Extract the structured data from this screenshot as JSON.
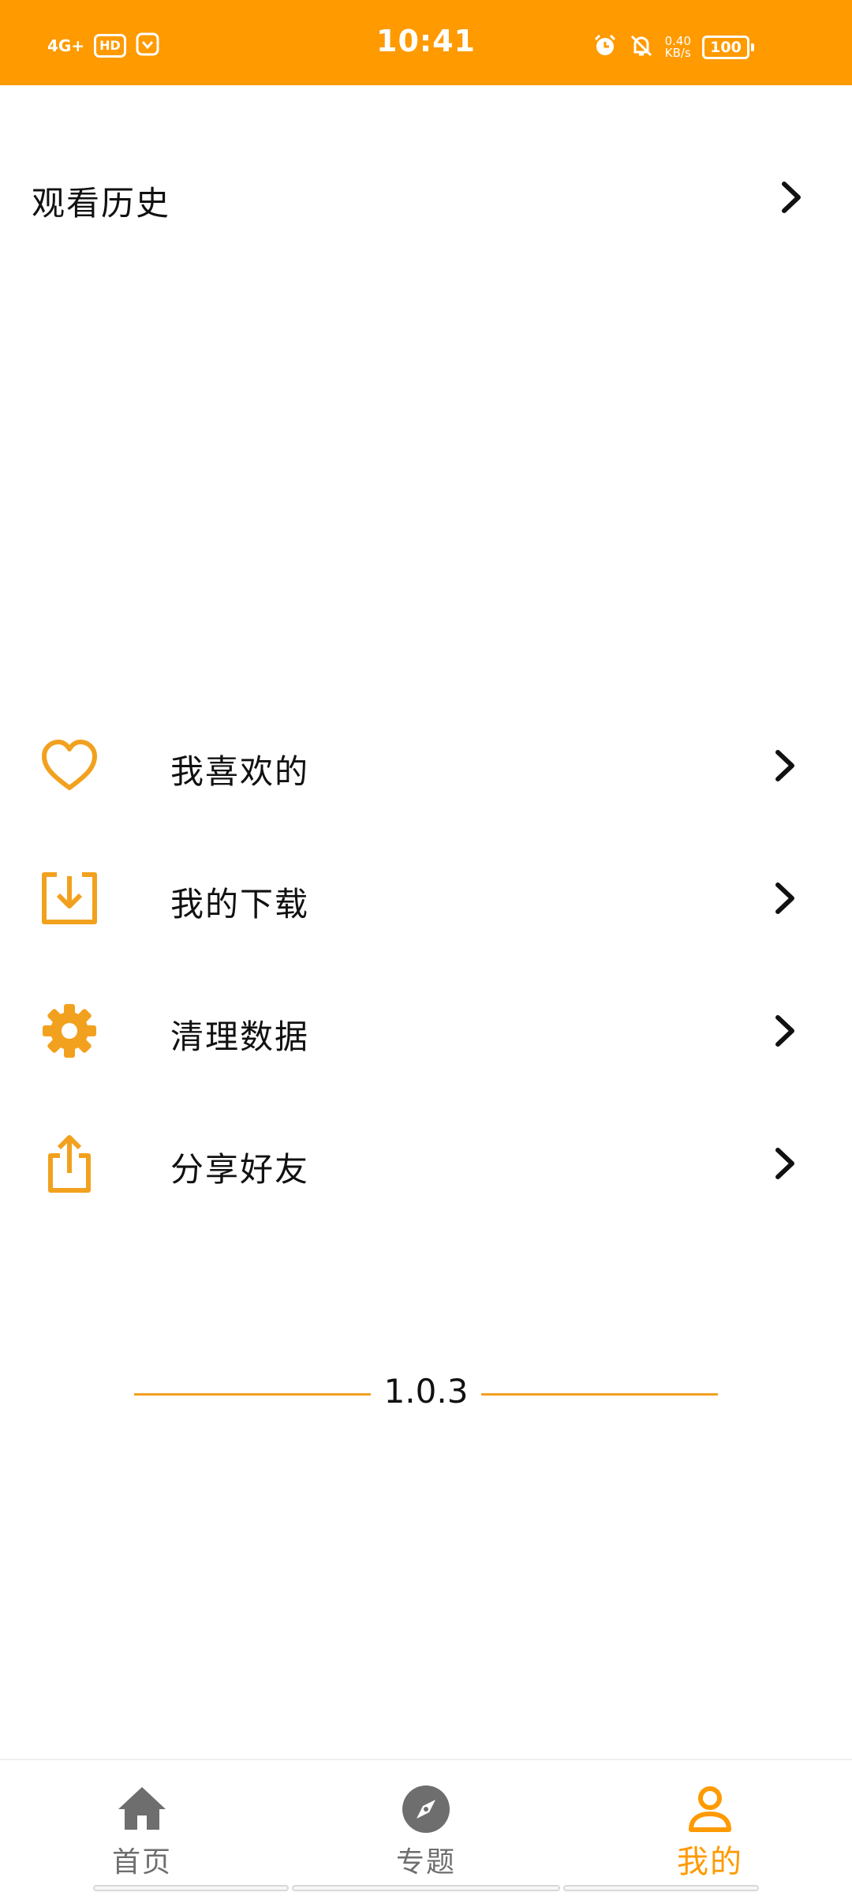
{
  "status_bar": {
    "network": "4G+",
    "hd_badge": "HD",
    "time": "10:41",
    "speed_value": "0.40",
    "speed_unit": "KB/s",
    "battery": "100",
    "icons": [
      "signal-icon",
      "hd-icon",
      "app-notification-icon",
      "alarm-icon",
      "mute-bell-icon",
      "battery-icon"
    ]
  },
  "history": {
    "label": "观看历史",
    "icon": "chevron-right-icon"
  },
  "menu": {
    "items": [
      {
        "label": "我喜欢的",
        "icon": "heart-icon"
      },
      {
        "label": "我的下载",
        "icon": "download-icon"
      },
      {
        "label": "清理数据",
        "icon": "gear-icon"
      },
      {
        "label": "分享好友",
        "icon": "share-icon"
      }
    ]
  },
  "version": "1.0.3",
  "bottom_nav": {
    "items": [
      {
        "label": "首页",
        "icon": "home-icon",
        "active": false
      },
      {
        "label": "专题",
        "icon": "compass-icon",
        "active": false
      },
      {
        "label": "我的",
        "icon": "user-icon",
        "active": true
      }
    ]
  },
  "colors": {
    "accent": "#FF9A00",
    "inactive": "#6E6E6E",
    "text": "#111111"
  }
}
